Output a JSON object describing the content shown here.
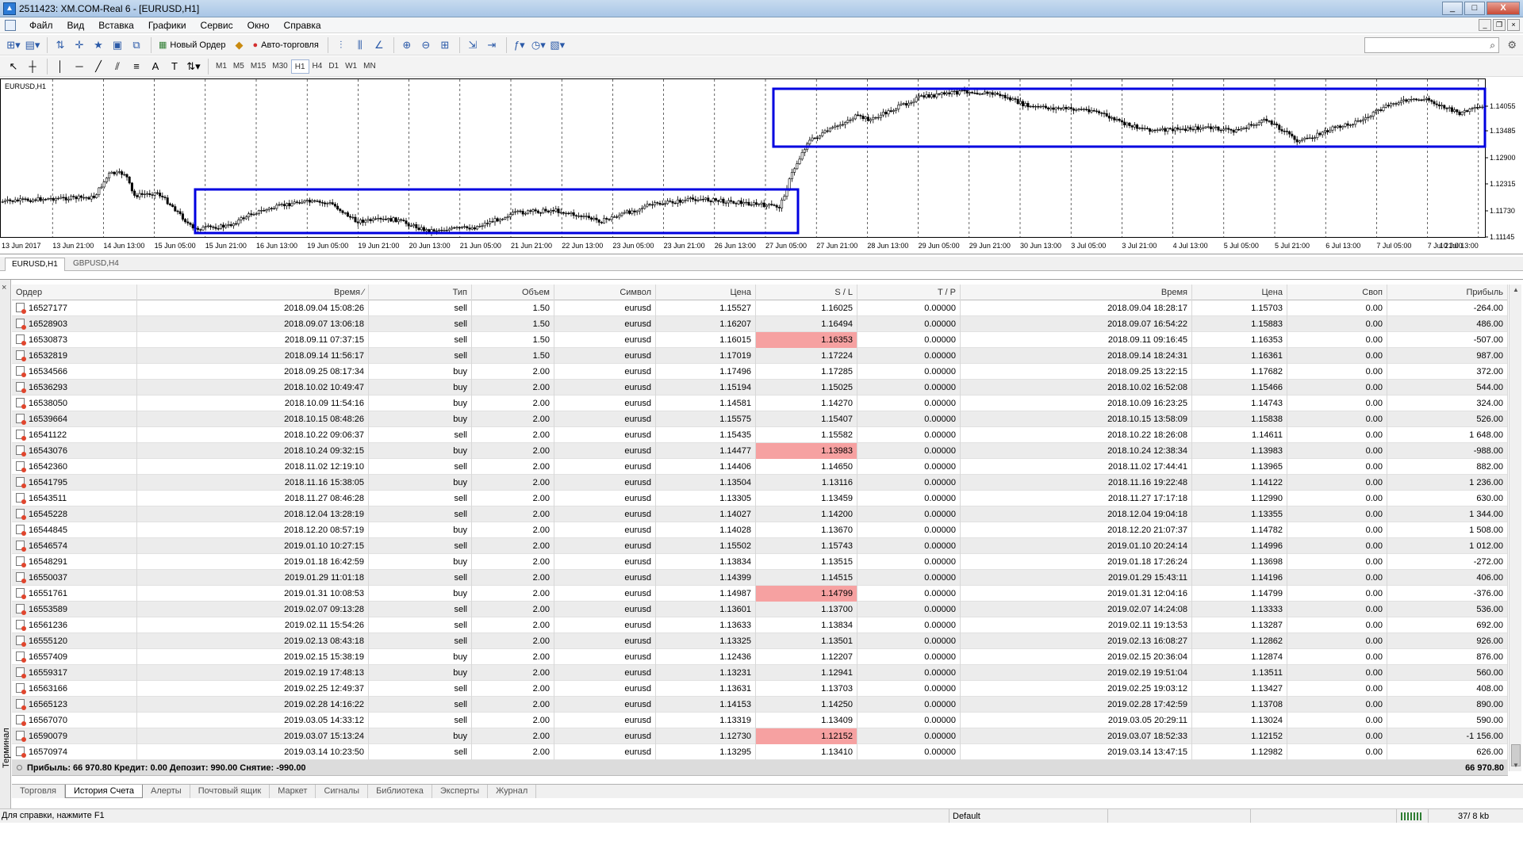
{
  "window": {
    "title": "2511423: XM.COM-Real 6 - [EURUSD,H1]",
    "minimize": "_",
    "maximize": "□",
    "close": "X"
  },
  "menu": [
    "Файл",
    "Вид",
    "Вставка",
    "Графики",
    "Сервис",
    "Окно",
    "Справка"
  ],
  "toolbar": {
    "new_order": "Новый Ордер",
    "auto_trading": "Авто-торговля"
  },
  "timeframes": [
    "M1",
    "M5",
    "M15",
    "M30",
    "H1",
    "H4",
    "D1",
    "W1",
    "MN"
  ],
  "active_timeframe": "H1",
  "chart": {
    "label": "EURUSD,H1",
    "accent_color": "#0000e0",
    "price_labels": [
      "1.14055",
      "1.13485",
      "1.12900",
      "1.12315",
      "1.11730",
      "1.11145"
    ],
    "time_labels": [
      "13 Jun 2017",
      "13 Jun 21:00",
      "14 Jun 13:00",
      "15 Jun 05:00",
      "15 Jun 21:00",
      "16 Jun 13:00",
      "19 Jun 05:00",
      "19 Jun 21:00",
      "20 Jun 13:00",
      "21 Jun 05:00",
      "21 Jun 21:00",
      "22 Jun 13:00",
      "23 Jun 05:00",
      "23 Jun 21:00",
      "26 Jun 13:00",
      "27 Jun 05:00",
      "27 Jun 21:00",
      "28 Jun 13:00",
      "29 Jun 05:00",
      "29 Jun 21:00",
      "30 Jun 13:00",
      "3 Jul 05:00",
      "3 Jul 21:00",
      "4 Jul 13:00",
      "5 Jul 05:00",
      "5 Jul 21:00",
      "6 Jul 13:00",
      "7 Jul 05:00",
      "7 Jul 21:00",
      "10 Jul 13:00"
    ]
  },
  "chart_tabs": [
    "EURUSD,H1",
    "GBPUSD,H4"
  ],
  "terminal": {
    "side_label": "Терминал",
    "close": "×",
    "columns": [
      "Ордер",
      "Время",
      "Тип",
      "Объем",
      "Символ",
      "Цена",
      "S / L",
      "T / P",
      "Время",
      "Цена",
      "Своп",
      "Прибыль"
    ],
    "rows": [
      [
        "16527177",
        "2018.09.04 15:08:26",
        "sell",
        "1.50",
        "eurusd",
        "1.15527",
        "1.16025",
        "0.00000",
        "2018.09.04 18:28:17",
        "1.15703",
        "0.00",
        "-264.00"
      ],
      [
        "16528903",
        "2018.09.07 13:06:18",
        "sell",
        "1.50",
        "eurusd",
        "1.16207",
        "1.16494",
        "0.00000",
        "2018.09.07 16:54:22",
        "1.15883",
        "0.00",
        "486.00"
      ],
      [
        "16530873",
        "2018.09.11 07:37:15",
        "sell",
        "1.50",
        "eurusd",
        "1.16015",
        "1.16353",
        "0.00000",
        "2018.09.11 09:16:45",
        "1.16353",
        "0.00",
        "-507.00"
      ],
      [
        "16532819",
        "2018.09.14 11:56:17",
        "sell",
        "1.50",
        "eurusd",
        "1.17019",
        "1.17224",
        "0.00000",
        "2018.09.14 18:24:31",
        "1.16361",
        "0.00",
        "987.00"
      ],
      [
        "16534566",
        "2018.09.25 08:17:34",
        "buy",
        "2.00",
        "eurusd",
        "1.17496",
        "1.17285",
        "0.00000",
        "2018.09.25 13:22:15",
        "1.17682",
        "0.00",
        "372.00"
      ],
      [
        "16536293",
        "2018.10.02 10:49:47",
        "buy",
        "2.00",
        "eurusd",
        "1.15194",
        "1.15025",
        "0.00000",
        "2018.10.02 16:52:08",
        "1.15466",
        "0.00",
        "544.00"
      ],
      [
        "16538050",
        "2018.10.09 11:54:16",
        "buy",
        "2.00",
        "eurusd",
        "1.14581",
        "1.14270",
        "0.00000",
        "2018.10.09 16:23:25",
        "1.14743",
        "0.00",
        "324.00"
      ],
      [
        "16539664",
        "2018.10.15 08:48:26",
        "buy",
        "2.00",
        "eurusd",
        "1.15575",
        "1.15407",
        "0.00000",
        "2018.10.15 13:58:09",
        "1.15838",
        "0.00",
        "526.00"
      ],
      [
        "16541122",
        "2018.10.22 09:06:37",
        "sell",
        "2.00",
        "eurusd",
        "1.15435",
        "1.15582",
        "0.00000",
        "2018.10.22 18:26:08",
        "1.14611",
        "0.00",
        "1 648.00"
      ],
      [
        "16543076",
        "2018.10.24 09:32:15",
        "buy",
        "2.00",
        "eurusd",
        "1.14477",
        "1.13983",
        "0.00000",
        "2018.10.24 12:38:34",
        "1.13983",
        "0.00",
        "-988.00"
      ],
      [
        "16542360",
        "2018.11.02 12:19:10",
        "sell",
        "2.00",
        "eurusd",
        "1.14406",
        "1.14650",
        "0.00000",
        "2018.11.02 17:44:41",
        "1.13965",
        "0.00",
        "882.00"
      ],
      [
        "16541795",
        "2018.11.16 15:38:05",
        "buy",
        "2.00",
        "eurusd",
        "1.13504",
        "1.13116",
        "0.00000",
        "2018.11.16 19:22:48",
        "1.14122",
        "0.00",
        "1 236.00"
      ],
      [
        "16543511",
        "2018.11.27 08:46:28",
        "sell",
        "2.00",
        "eurusd",
        "1.13305",
        "1.13459",
        "0.00000",
        "2018.11.27 17:17:18",
        "1.12990",
        "0.00",
        "630.00"
      ],
      [
        "16545228",
        "2018.12.04 13:28:19",
        "sell",
        "2.00",
        "eurusd",
        "1.14027",
        "1.14200",
        "0.00000",
        "2018.12.04 19:04:18",
        "1.13355",
        "0.00",
        "1 344.00"
      ],
      [
        "16544845",
        "2018.12.20 08:57:19",
        "buy",
        "2.00",
        "eurusd",
        "1.14028",
        "1.13670",
        "0.00000",
        "2018.12.20 21:07:37",
        "1.14782",
        "0.00",
        "1 508.00"
      ],
      [
        "16546574",
        "2019.01.10 10:27:15",
        "sell",
        "2.00",
        "eurusd",
        "1.15502",
        "1.15743",
        "0.00000",
        "2019.01.10 20:24:14",
        "1.14996",
        "0.00",
        "1 012.00"
      ],
      [
        "16548291",
        "2019.01.18 16:42:59",
        "buy",
        "2.00",
        "eurusd",
        "1.13834",
        "1.13515",
        "0.00000",
        "2019.01.18 17:26:24",
        "1.13698",
        "0.00",
        "-272.00"
      ],
      [
        "16550037",
        "2019.01.29 11:01:18",
        "sell",
        "2.00",
        "eurusd",
        "1.14399",
        "1.14515",
        "0.00000",
        "2019.01.29 15:43:11",
        "1.14196",
        "0.00",
        "406.00"
      ],
      [
        "16551761",
        "2019.01.31 10:08:53",
        "buy",
        "2.00",
        "eurusd",
        "1.14987",
        "1.14799",
        "0.00000",
        "2019.01.31 12:04:16",
        "1.14799",
        "0.00",
        "-376.00"
      ],
      [
        "16553589",
        "2019.02.07 09:13:28",
        "sell",
        "2.00",
        "eurusd",
        "1.13601",
        "1.13700",
        "0.00000",
        "2019.02.07 14:24:08",
        "1.13333",
        "0.00",
        "536.00"
      ],
      [
        "16561236",
        "2019.02.11 15:54:26",
        "sell",
        "2.00",
        "eurusd",
        "1.13633",
        "1.13834",
        "0.00000",
        "2019.02.11 19:13:53",
        "1.13287",
        "0.00",
        "692.00"
      ],
      [
        "16555120",
        "2019.02.13 08:43:18",
        "sell",
        "2.00",
        "eurusd",
        "1.13325",
        "1.13501",
        "0.00000",
        "2019.02.13 16:08:27",
        "1.12862",
        "0.00",
        "926.00"
      ],
      [
        "16557409",
        "2019.02.15 15:38:19",
        "buy",
        "2.00",
        "eurusd",
        "1.12436",
        "1.12207",
        "0.00000",
        "2019.02.15 20:36:04",
        "1.12874",
        "0.00",
        "876.00"
      ],
      [
        "16559317",
        "2019.02.19 17:48:13",
        "buy",
        "2.00",
        "eurusd",
        "1.13231",
        "1.12941",
        "0.00000",
        "2019.02.19 19:51:04",
        "1.13511",
        "0.00",
        "560.00"
      ],
      [
        "16563166",
        "2019.02.25 12:49:37",
        "sell",
        "2.00",
        "eurusd",
        "1.13631",
        "1.13703",
        "0.00000",
        "2019.02.25 19:03:12",
        "1.13427",
        "0.00",
        "408.00"
      ],
      [
        "16565123",
        "2019.02.28 14:16:22",
        "sell",
        "2.00",
        "eurusd",
        "1.14153",
        "1.14250",
        "0.00000",
        "2019.02.28 17:42:59",
        "1.13708",
        "0.00",
        "890.00"
      ],
      [
        "16567070",
        "2019.03.05 14:33:12",
        "sell",
        "2.00",
        "eurusd",
        "1.13319",
        "1.13409",
        "0.00000",
        "2019.03.05 20:29:11",
        "1.13024",
        "0.00",
        "590.00"
      ],
      [
        "16590079",
        "2019.03.07 15:13:24",
        "buy",
        "2.00",
        "eurusd",
        "1.12730",
        "1.12152",
        "0.00000",
        "2019.03.07 18:52:33",
        "1.12152",
        "0.00",
        "-1 156.00"
      ],
      [
        "16570974",
        "2019.03.14 10:23:50",
        "sell",
        "2.00",
        "eurusd",
        "1.13295",
        "1.13410",
        "0.00000",
        "2019.03.14 13:47:15",
        "1.12982",
        "0.00",
        "626.00"
      ]
    ],
    "sl_hit_rows": [
      2,
      9,
      18,
      27
    ],
    "sl_hit_color": "#f6a1a1",
    "summary": "Прибыль: 66 970.80 Кредит: 0.00 Депозит: 990.00 Снятие: -990.00",
    "summary_total": "66 970.80",
    "tabs": [
      "Торговля",
      "История Счета",
      "Алерты",
      "Почтовый ящик",
      "Маркет",
      "Сигналы",
      "Библиотека",
      "Эксперты",
      "Журнал"
    ],
    "active_tab": "История Счета"
  },
  "status": {
    "help": "Для справки, нажмите F1",
    "profile": "Default",
    "traffic": "37/ 8 kb"
  }
}
